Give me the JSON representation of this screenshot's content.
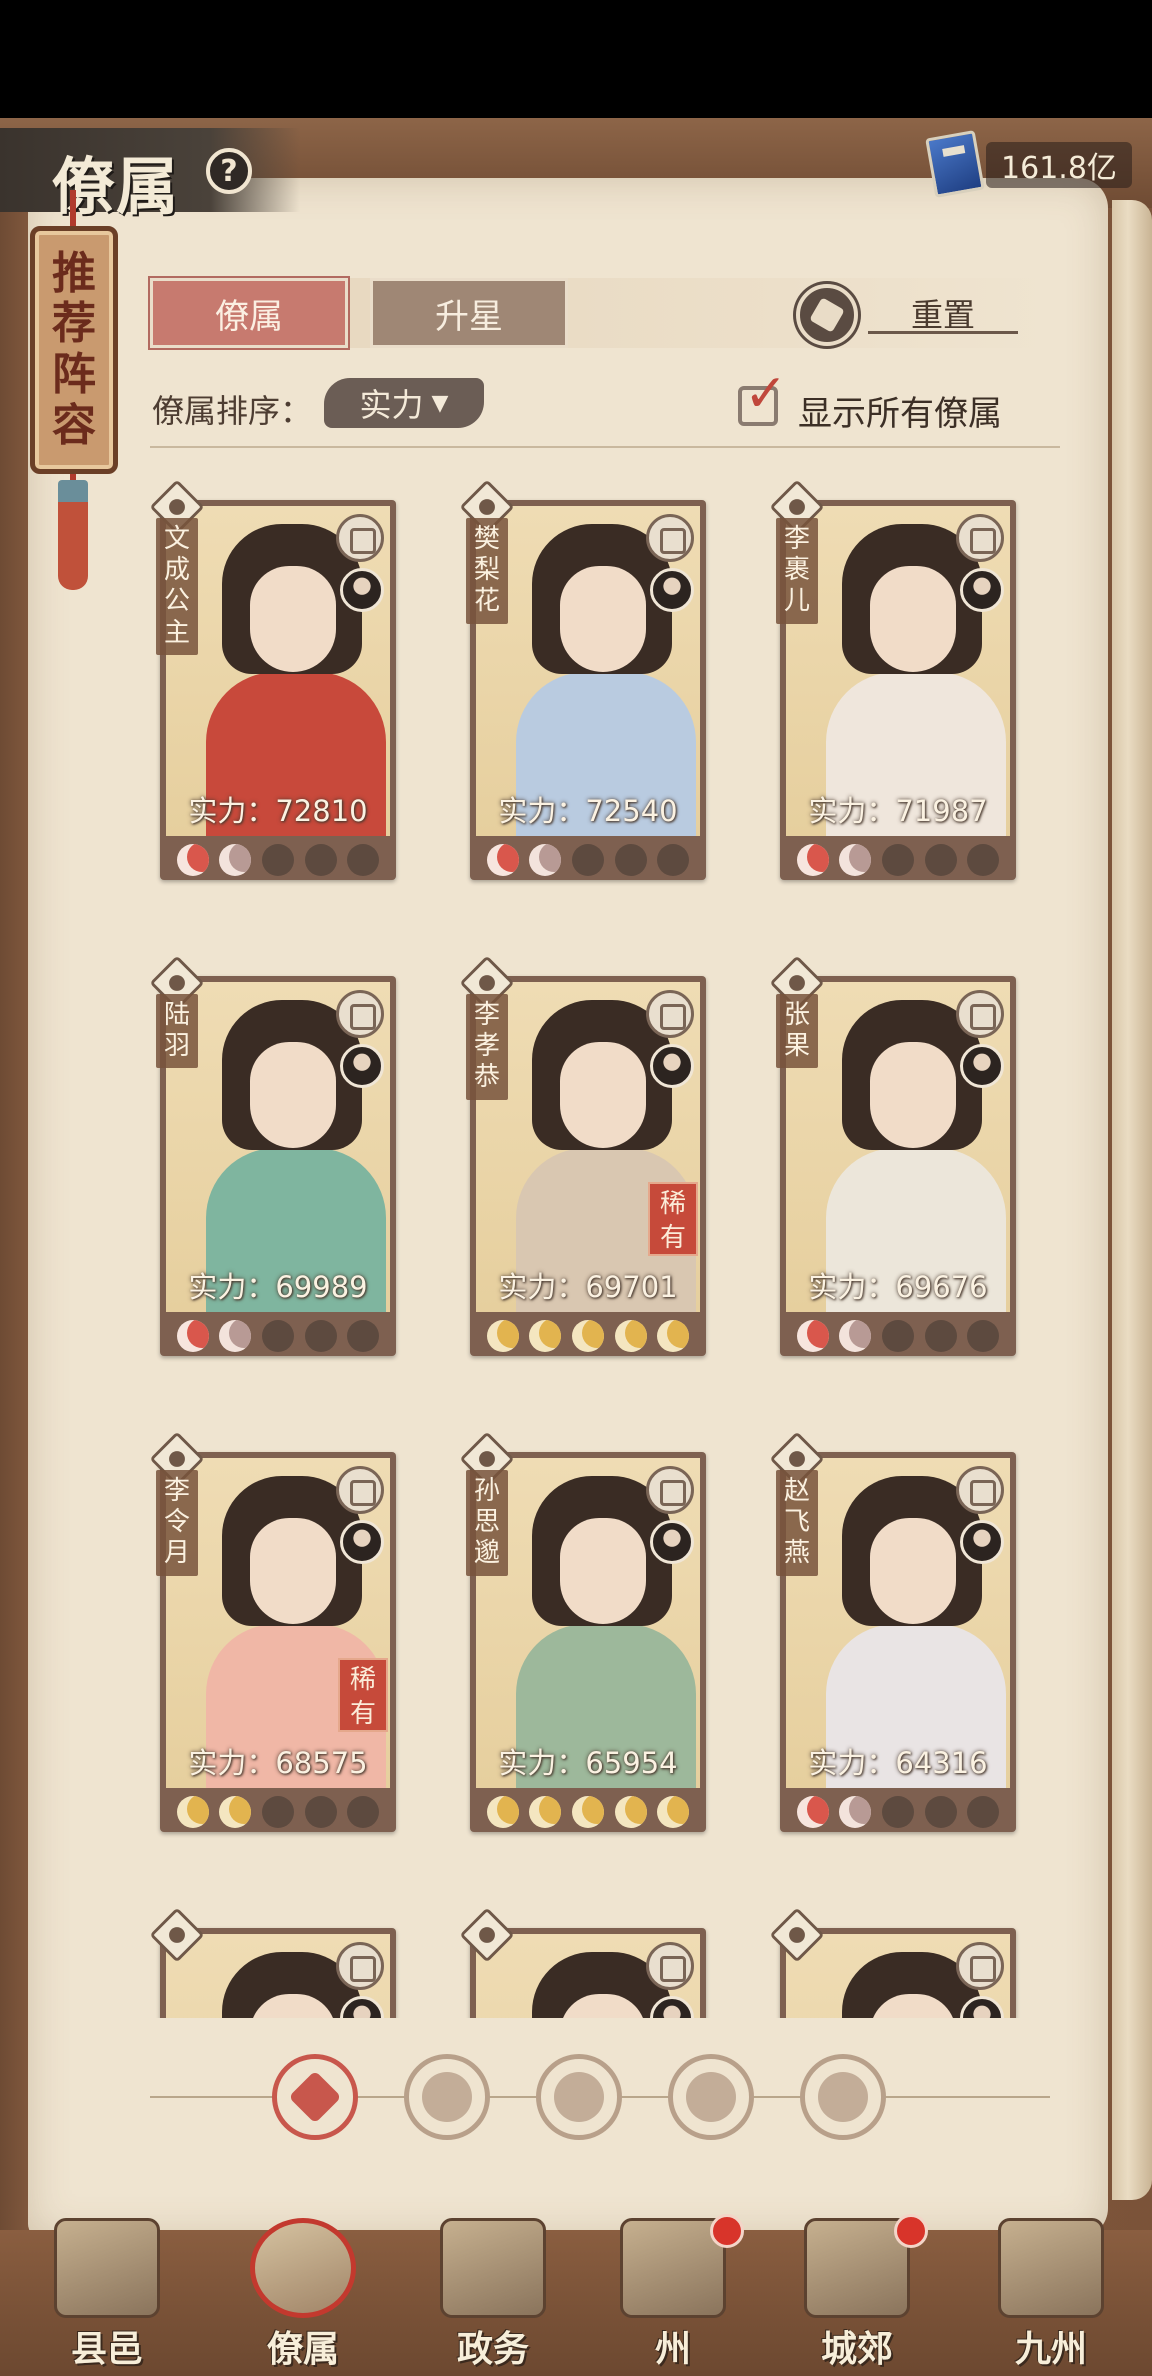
{
  "header": {
    "title": "僚属",
    "help_icon": "question-circle-icon",
    "currency": {
      "icon": "blue-book-icon",
      "amount": "161.8亿"
    }
  },
  "banner": {
    "chars": [
      "推",
      "荐",
      "阵",
      "容"
    ]
  },
  "tabs": [
    {
      "label": "僚属",
      "active": true
    },
    {
      "label": "升星",
      "active": false
    }
  ],
  "reset_label": "重置",
  "sort": {
    "label": "僚属排序：",
    "value": "实力"
  },
  "show_all": {
    "label": "显示所有僚属",
    "checked": true
  },
  "cards": [
    {
      "name": "文成公主",
      "power_label": "实力：72810",
      "power": 72810,
      "rare": "",
      "stars": [
        "red",
        "pink",
        "empty",
        "empty",
        "empty"
      ],
      "robe": "#c8493b"
    },
    {
      "name": "樊梨花",
      "power_label": "实力：72540",
      "power": 72540,
      "rare": "",
      "stars": [
        "red",
        "pink",
        "empty",
        "empty",
        "empty"
      ],
      "robe": "#b9cbe0"
    },
    {
      "name": "李裹儿",
      "power_label": "实力：71987",
      "power": 71987,
      "rare": "",
      "stars": [
        "red",
        "pink",
        "empty",
        "empty",
        "empty"
      ],
      "robe": "#efe6dc"
    },
    {
      "name": "陆羽",
      "power_label": "实力：69989",
      "power": 69989,
      "rare": "",
      "stars": [
        "red",
        "pink",
        "empty",
        "empty",
        "empty"
      ],
      "robe": "#7fb59f"
    },
    {
      "name": "李孝恭",
      "power_label": "实力：69701",
      "power": 69701,
      "rare": "稀有",
      "stars": [
        "gold",
        "gold",
        "gold",
        "gold",
        "gold"
      ],
      "robe": "#d9c7b1"
    },
    {
      "name": "张果",
      "power_label": "实力：69676",
      "power": 69676,
      "rare": "",
      "stars": [
        "red",
        "pink",
        "empty",
        "empty",
        "empty"
      ],
      "robe": "#ece6da"
    },
    {
      "name": "李令月",
      "power_label": "实力：68575",
      "power": 68575,
      "rare": "稀有",
      "stars": [
        "gold",
        "gold",
        "empty",
        "empty",
        "empty"
      ],
      "robe": "#f0b7a6"
    },
    {
      "name": "孙思邈",
      "power_label": "实力：65954",
      "power": 65954,
      "rare": "",
      "stars": [
        "gold",
        "gold",
        "gold",
        "gold",
        "gold"
      ],
      "robe": "#9db89b"
    },
    {
      "name": "赵飞燕",
      "power_label": "实力：64316",
      "power": 64316,
      "rare": "",
      "stars": [
        "red",
        "pink",
        "empty",
        "empty",
        "empty"
      ],
      "robe": "#e9e4e4"
    },
    {
      "name": "",
      "power_label": "",
      "power": null,
      "rare": "",
      "stars": [],
      "robe": "#d6b392"
    },
    {
      "name": "",
      "power_label": "",
      "power": null,
      "rare": "",
      "stars": [],
      "robe": "#9f8fb8"
    },
    {
      "name": "",
      "power_label": "",
      "power": null,
      "rare": "",
      "stars": [],
      "robe": "#d6b392"
    }
  ],
  "filters": [
    {
      "icon": "all-diamond-icon",
      "active": true
    },
    {
      "icon": "bell-class-icon",
      "active": false
    },
    {
      "icon": "cat-class-icon",
      "active": false
    },
    {
      "icon": "fan-class-icon",
      "active": false
    },
    {
      "icon": "lion-class-icon",
      "active": false
    }
  ],
  "nav": [
    {
      "label": "县邑",
      "active": false,
      "badge": false
    },
    {
      "label": "僚属",
      "active": true,
      "badge": false
    },
    {
      "label": "政务",
      "active": false,
      "badge": false
    },
    {
      "label": "州",
      "active": false,
      "badge": true
    },
    {
      "label": "城郊",
      "active": false,
      "badge": true
    },
    {
      "label": "九州",
      "active": false,
      "badge": false
    }
  ]
}
